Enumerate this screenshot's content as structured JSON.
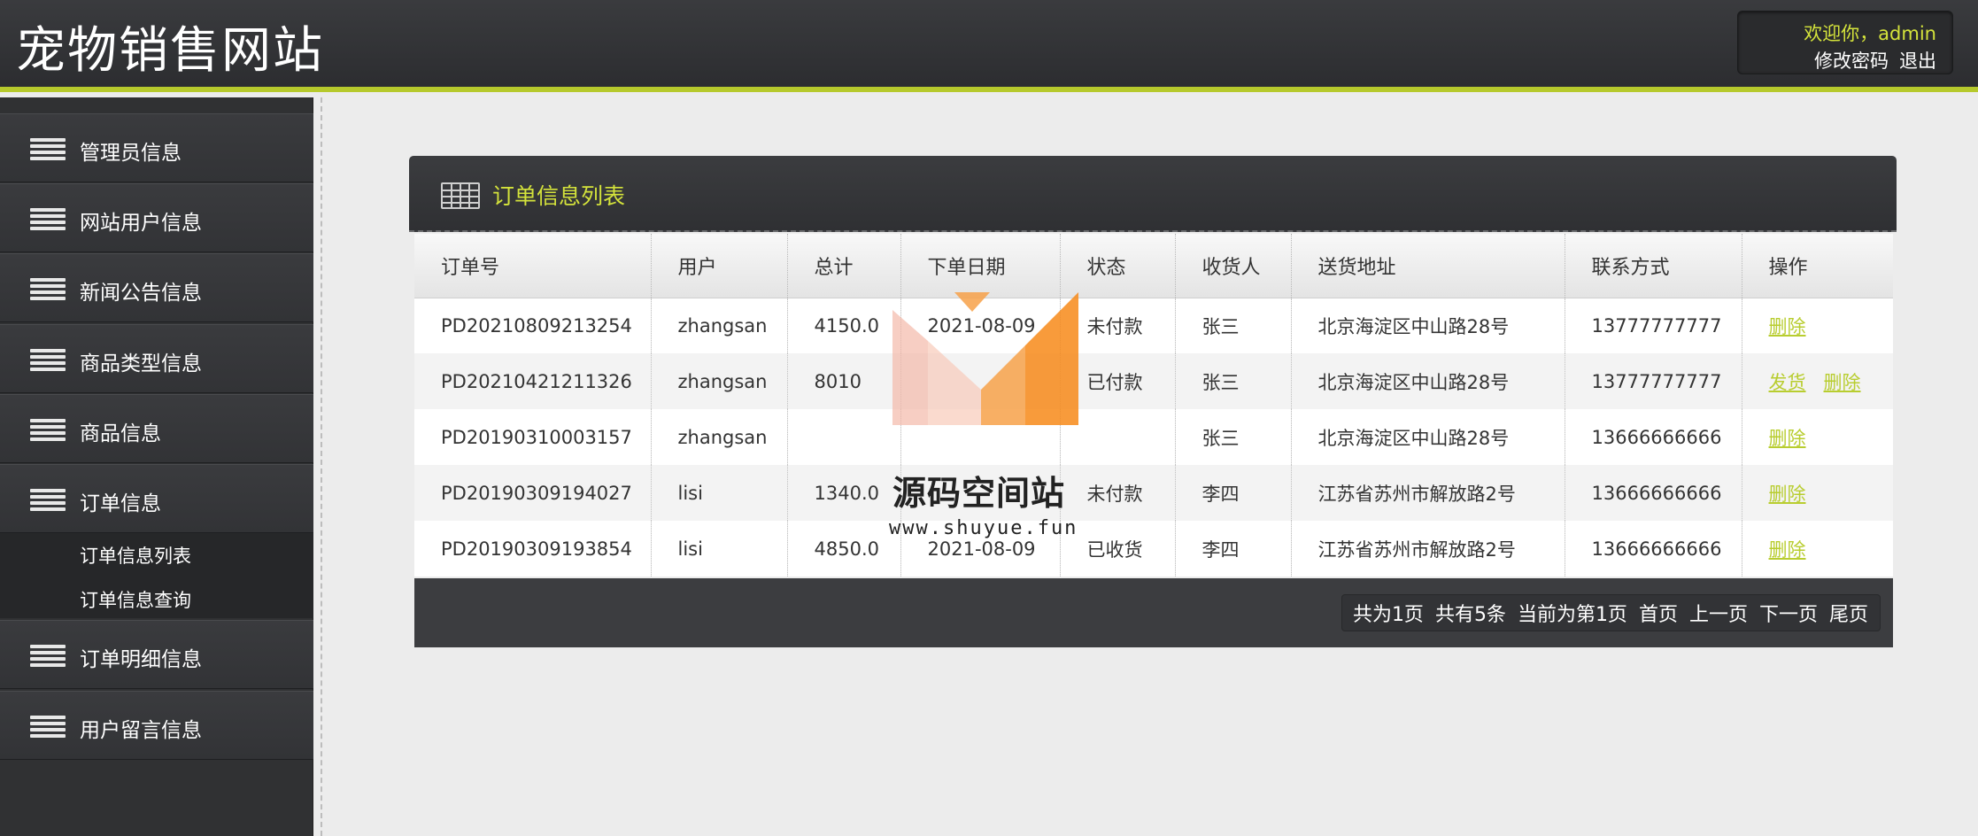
{
  "header": {
    "title": "宠物销售网站",
    "welcome": "欢迎你，admin",
    "change_password": "修改密码",
    "logout": "退出"
  },
  "sidebar": {
    "items": [
      {
        "label": "管理员信息"
      },
      {
        "label": "网站用户信息"
      },
      {
        "label": "新闻公告信息"
      },
      {
        "label": "商品类型信息"
      },
      {
        "label": "商品信息"
      },
      {
        "label": "订单信息"
      },
      {
        "label": "订单明细信息"
      },
      {
        "label": "用户留言信息"
      }
    ],
    "submenu": [
      {
        "label": "订单信息列表"
      },
      {
        "label": "订单信息查询"
      }
    ]
  },
  "panel": {
    "title": "订单信息列表",
    "columns": [
      "订单号",
      "用户",
      "总计",
      "下单日期",
      "状态",
      "收货人",
      "送货地址",
      "联系方式",
      "操作"
    ],
    "rows": [
      {
        "id": "PD20210809213254",
        "user": "zhangsan",
        "total": "4150.0",
        "date": "2021-08-09",
        "status": "未付款",
        "receiver": "张三",
        "address": "北京海淀区中山路28号",
        "phone": "13777777777",
        "actions": [
          "删除"
        ]
      },
      {
        "id": "PD20210421211326",
        "user": "zhangsan",
        "total": "8010",
        "date": "",
        "status": "已付款",
        "receiver": "张三",
        "address": "北京海淀区中山路28号",
        "phone": "13777777777",
        "actions": [
          "发货",
          "删除"
        ]
      },
      {
        "id": "PD20190310003157",
        "user": "zhangsan",
        "total": "",
        "date": "",
        "status": "",
        "receiver": "张三",
        "address": "北京海淀区中山路28号",
        "phone": "13666666666",
        "actions": [
          "删除"
        ]
      },
      {
        "id": "PD20190309194027",
        "user": "lisi",
        "total": "1340.0",
        "date": "",
        "status": "未付款",
        "receiver": "李四",
        "address": "江苏省苏州市解放路2号",
        "phone": "13666666666",
        "actions": [
          "删除"
        ]
      },
      {
        "id": "PD20190309193854",
        "user": "lisi",
        "total": "4850.0",
        "date": "2021-08-09",
        "status": "已收货",
        "receiver": "李四",
        "address": "江苏省苏州市解放路2号",
        "phone": "13666666666",
        "actions": [
          "删除"
        ]
      }
    ]
  },
  "pager": {
    "total_pages": "共为1页",
    "total_records": "共有5条",
    "current": "当前为第1页",
    "first": "首页",
    "prev": "上一页",
    "next": "下一页",
    "last": "尾页"
  },
  "watermark": {
    "text": "源码空间站",
    "url": "www.shuyue.fun"
  },
  "colors": {
    "accent": "#d4e33b",
    "link": "#b8cd2f",
    "header_bg": "#2f3033",
    "sidebar_bg": "#303133"
  }
}
